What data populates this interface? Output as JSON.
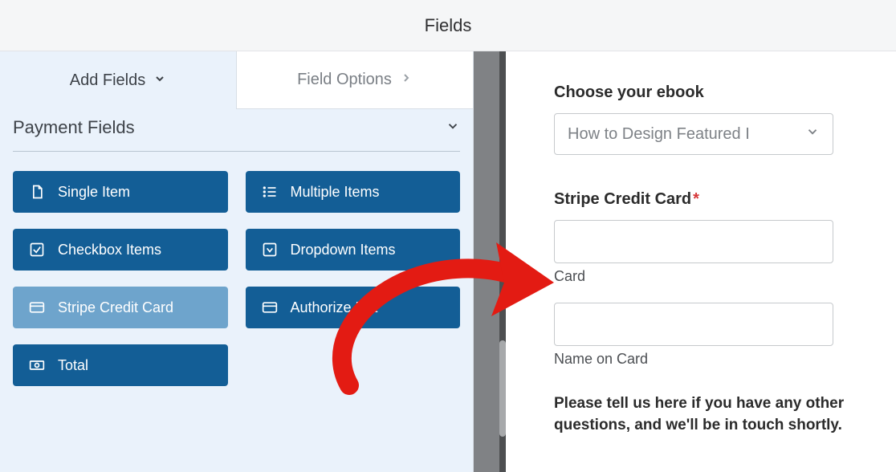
{
  "header": {
    "title": "Fields"
  },
  "tabs": {
    "add": "Add Fields",
    "options": "Field Options"
  },
  "section": {
    "title": "Payment Fields"
  },
  "fields": {
    "single_item": "Single Item",
    "multiple_items": "Multiple Items",
    "checkbox_items": "Checkbox Items",
    "dropdown_items": "Dropdown Items",
    "stripe": "Stripe Credit Card",
    "authorize": "Authorize.Net",
    "total": "Total"
  },
  "preview": {
    "ebook_label": "Choose your ebook",
    "ebook_value": "How to Design Featured I",
    "stripe_label": "Stripe Credit Card",
    "required_mark": "*",
    "card_label": "Card",
    "name_label": "Name on Card",
    "help_text": "Please tell us here if you have any other questions, and we'll be in touch shortly."
  }
}
